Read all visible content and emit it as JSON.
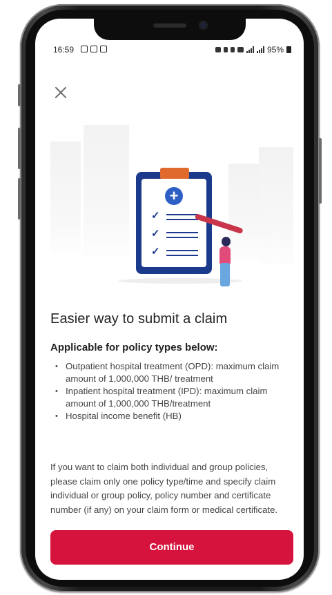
{
  "status_bar": {
    "time": "16:59",
    "battery": "95%"
  },
  "header": {
    "close_icon": "close-icon"
  },
  "content": {
    "title": "Easier way to submit a claim",
    "subtitle": "Applicable for policy types below:",
    "bullets": [
      "Outpatient hospital treatment (OPD): maximum claim amount of 1,000,000 THB/ treatment",
      "Inpatient hospital treatment (IPD): maximum claim amount of 1,000,000 THB/treatment",
      "Hospital income benefit (HB)"
    ],
    "note": "If you want to claim both individual and group policies, please claim only one policy type/time and specify claim individual or group policy, policy number and certificate number (if any) on your claim form or medical certificate."
  },
  "footer": {
    "continue_label": "Continue"
  },
  "colors": {
    "accent": "#d5133c",
    "clipboard": "#1c3a8c",
    "clip_top": "#e0692e"
  }
}
